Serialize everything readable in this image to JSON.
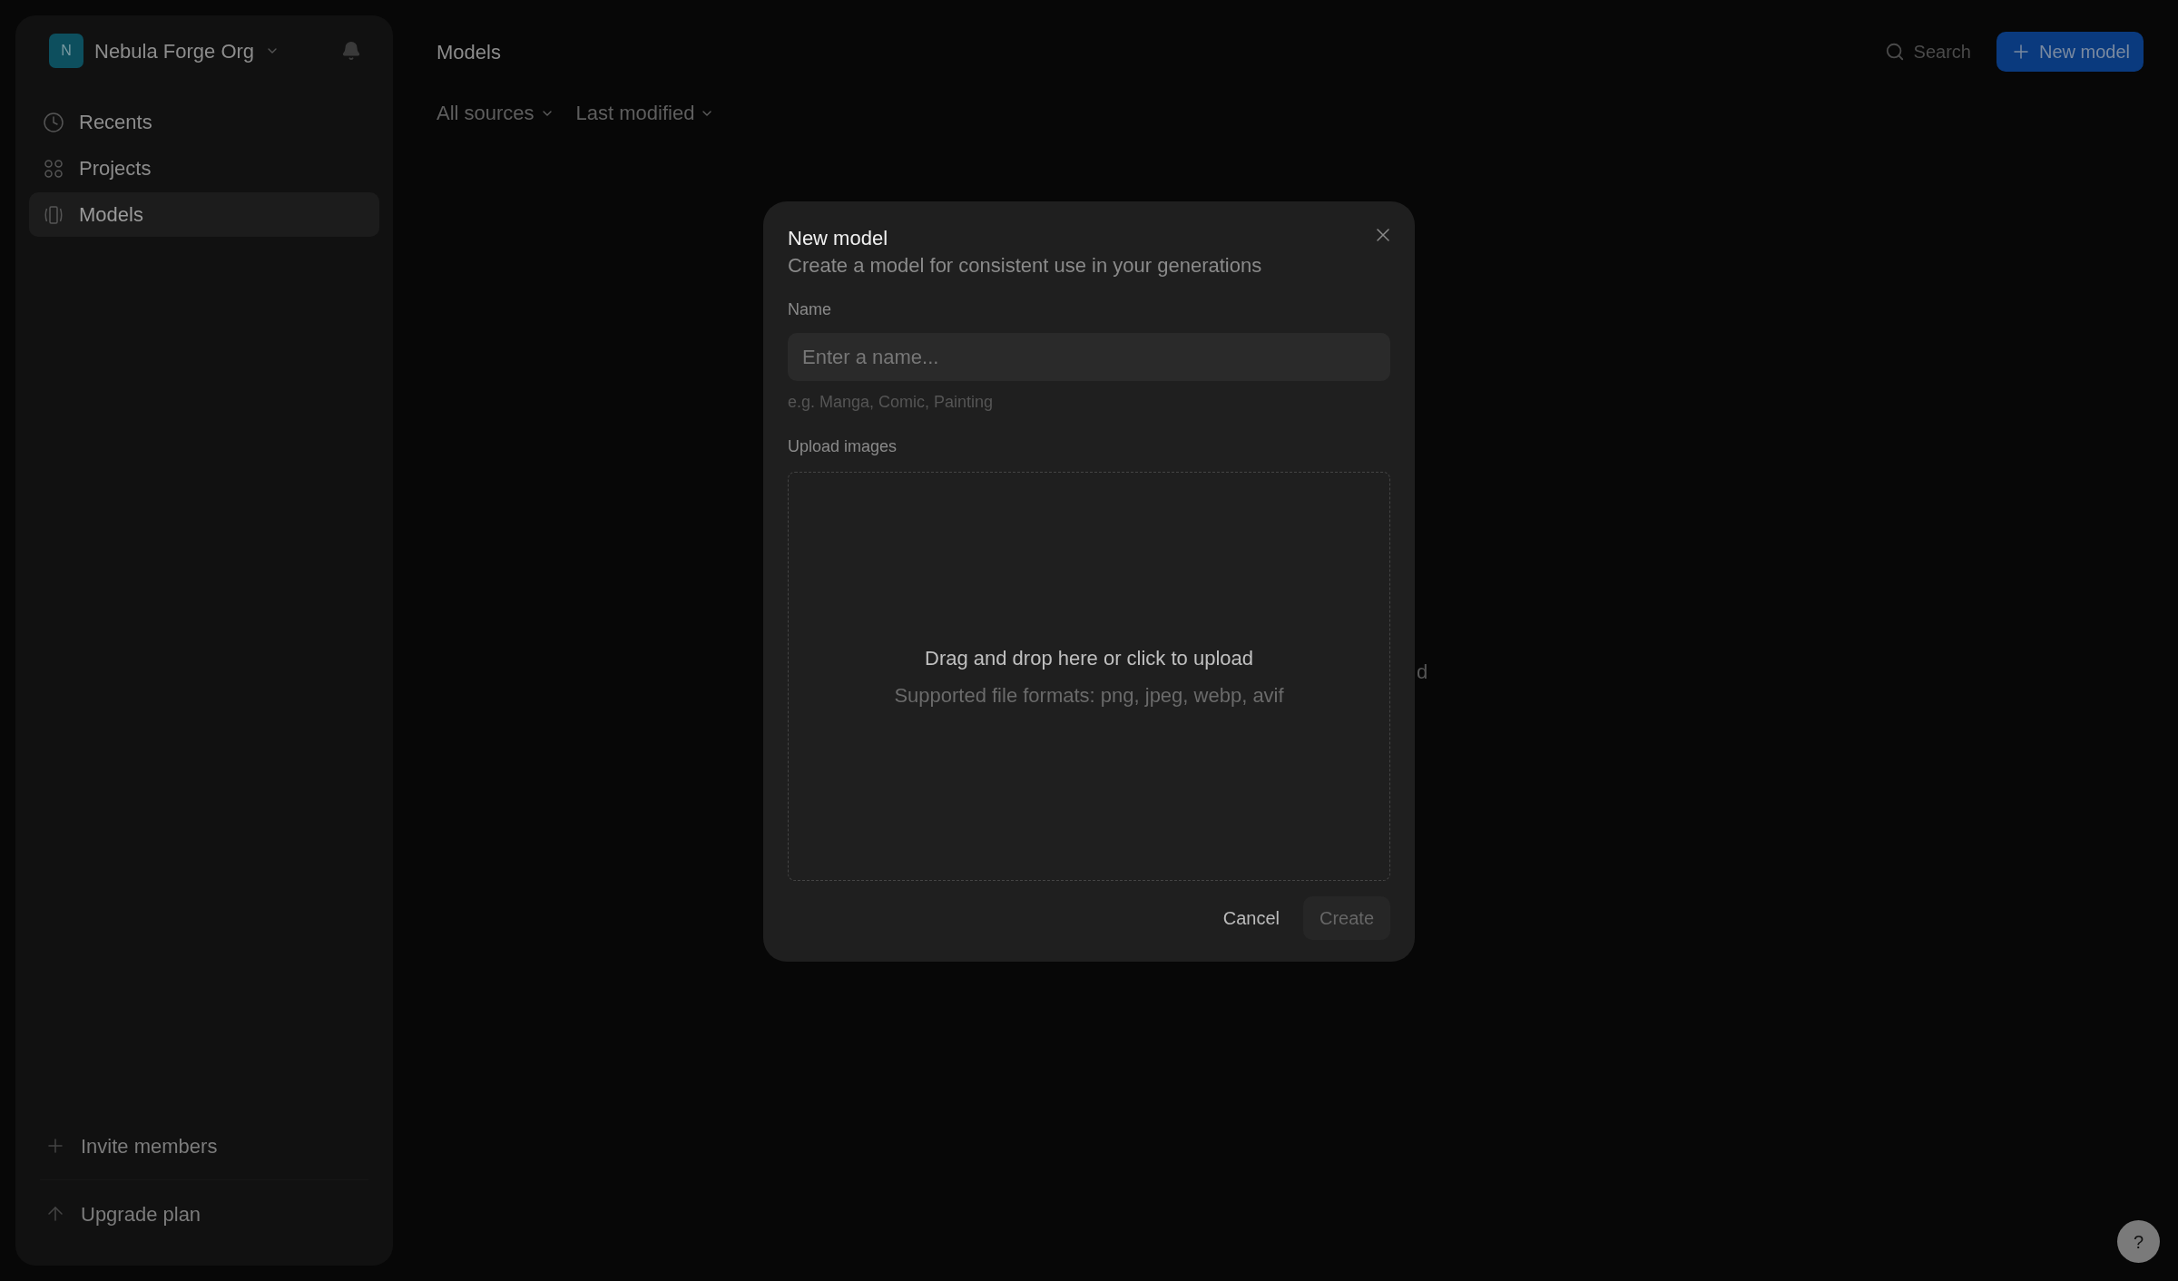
{
  "sidebar": {
    "org": {
      "initial": "N",
      "name": "Nebula Forge Org"
    },
    "items": [
      {
        "label": "Recents",
        "kind": "recents",
        "selected": false
      },
      {
        "label": "Projects",
        "kind": "projects",
        "selected": false
      },
      {
        "label": "Models",
        "kind": "models",
        "selected": true
      }
    ],
    "footer": [
      {
        "label": "Invite members",
        "kind": "invite"
      },
      {
        "label": "Upgrade plan",
        "kind": "upgrade"
      }
    ]
  },
  "header": {
    "title": "Models",
    "search": "Search",
    "new_button": "New model"
  },
  "filters": [
    "All sources",
    "Last modified"
  ],
  "background_text": "d",
  "dialog": {
    "title": "New model",
    "subtitle": "Create a model for consistent use in your generations",
    "name_label": "Name",
    "name_placeholder": "Enter a name...",
    "name_hint": "e.g. Manga, Comic, Painting",
    "upload_label": "Upload images",
    "drop_title": "Drag and drop here or click to upload",
    "drop_hint": "Supported file formats: png, jpeg, webp, avif",
    "cancel": "Cancel",
    "create": {
      "label": "Create",
      "disabled": true
    }
  },
  "help": "?"
}
